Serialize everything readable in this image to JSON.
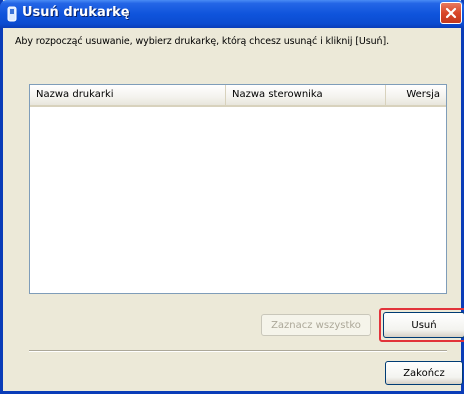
{
  "window": {
    "title": "Usuń drukarkę"
  },
  "instruction": "Aby rozpocząć usuwanie, wybierz drukarkę, którą chcesz usunąć i kliknij [Usuń].",
  "listview": {
    "columns": [
      "Nazwa drukarki",
      "Nazwa sterownika",
      "Wersja"
    ],
    "rows": []
  },
  "buttons": {
    "select_all": "Zaznacz wszystko",
    "delete": "Usuń",
    "finish": "Zakończ"
  },
  "colors": {
    "title_bar": "#0f54dc",
    "highlight": "#e2333a"
  }
}
